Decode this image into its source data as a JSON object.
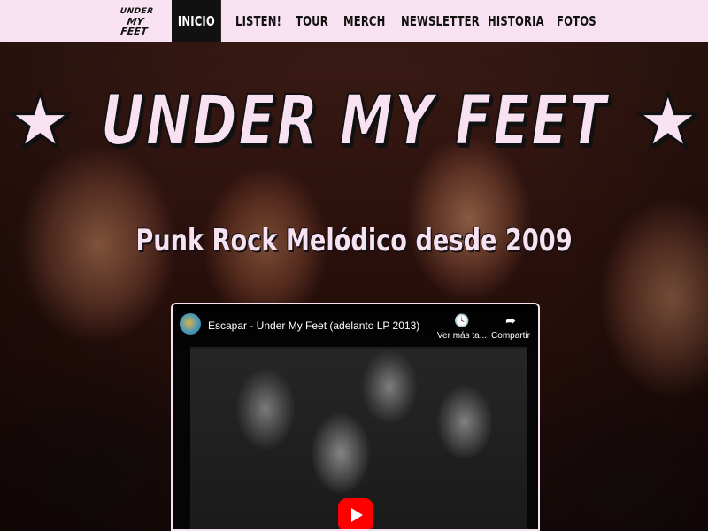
{
  "nav": {
    "logo_line1": "UNDER",
    "logo_line2": "MY FEET",
    "items": [
      {
        "label": "INICIO",
        "active": true
      },
      {
        "label": "LISTEN!"
      },
      {
        "label": "TOUR"
      },
      {
        "label": "MERCH"
      },
      {
        "label": "NEWSLETTER"
      },
      {
        "label": "HISTORIA"
      },
      {
        "label": "FOTOS"
      }
    ]
  },
  "hero": {
    "star": "★",
    "band_name": "UNDER MY FEET",
    "tagline": "Punk Rock Melódico desde 2009"
  },
  "video": {
    "title": "Escapar - Under My Feet (adelanto LP 2013)",
    "watch_later": "Ver más ta...",
    "share": "Compartir",
    "watch_later_icon": "🕓",
    "share_icon": "➦"
  },
  "colors": {
    "nav_bg": "#f8e1f1",
    "active_bg": "#111111",
    "accent_pink": "#f8e1f1",
    "youtube_red": "#ff0000"
  }
}
